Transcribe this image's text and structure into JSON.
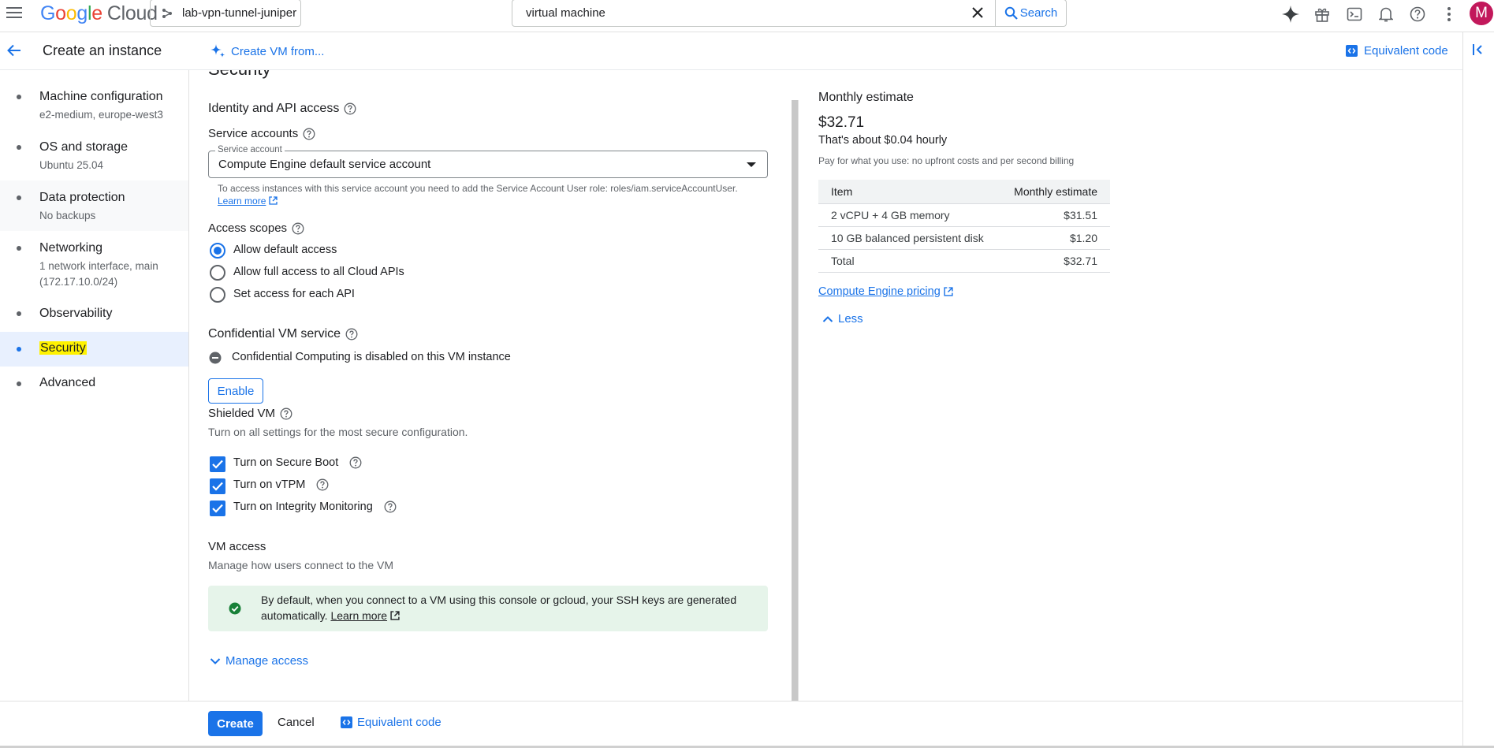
{
  "topbar": {
    "logo_google": [
      "G",
      "o",
      "o",
      "g",
      "l",
      "e"
    ],
    "logo_cloud": "Cloud",
    "project": "lab-vpn-tunnel-juniper",
    "search_value": "virtual machine",
    "search_button": "Search",
    "avatar_letter": "M"
  },
  "header": {
    "title": "Create an instance",
    "create_from": "Create VM from...",
    "equivalent_code": "Equivalent code"
  },
  "nav": {
    "items": [
      {
        "title": "Machine configuration",
        "sub": "e2-medium, europe-west3"
      },
      {
        "title": "OS and storage",
        "sub": "Ubuntu 25.04"
      },
      {
        "title": "Data protection",
        "sub": "No backups"
      },
      {
        "title": "Networking",
        "sub": "1 network interface, main",
        "sub2": "(172.17.10.0/24)"
      },
      {
        "title": "Observability"
      },
      {
        "title": "Security"
      },
      {
        "title": "Advanced"
      }
    ]
  },
  "main": {
    "section_title": "Security",
    "identity_title": "Identity and API access",
    "service_accounts_label": "Service accounts",
    "service_account_float": "Service account",
    "service_account_value": "Compute Engine default service account",
    "sa_help": "To access instances with this service account you need to add the Service Account User role: roles/iam.serviceAccountUser.",
    "learn_more": "Learn more",
    "access_scopes_label": "Access scopes",
    "scopes": [
      "Allow default access",
      "Allow full access to all Cloud APIs",
      "Set access for each API"
    ],
    "scopes_selected": 0,
    "confidential_title": "Confidential VM service",
    "confidential_status": "Confidential Computing is disabled on this VM instance",
    "enable_button": "Enable",
    "shielded_title": "Shielded VM",
    "shielded_desc": "Turn on all settings for the most secure configuration.",
    "shielded_options": [
      "Turn on Secure Boot",
      "Turn on vTPM",
      "Turn on Integrity Monitoring"
    ],
    "vm_access_title": "VM access",
    "vm_access_desc": "Manage how users connect to the VM",
    "info_text": "By default, when you connect to a VM using this console or gcloud, your SSH keys are generated automatically.",
    "info_link": "Learn more",
    "manage_access": "Manage access"
  },
  "estimate": {
    "title": "Monthly estimate",
    "price": "$32.71",
    "hourly": "That's about $0.04 hourly",
    "note": "Pay for what you use: no upfront costs and per second billing",
    "col_item": "Item",
    "col_estimate": "Monthly estimate",
    "rows": [
      {
        "item": "2 vCPU + 4 GB memory",
        "cost": "$31.51"
      },
      {
        "item": "10 GB balanced persistent disk",
        "cost": "$1.20"
      },
      {
        "item": "Total",
        "cost": "$32.71"
      }
    ],
    "pricing_link": "Compute Engine pricing",
    "less": "Less"
  },
  "bottom": {
    "create": "Create",
    "cancel": "Cancel",
    "equivalent_code": "Equivalent code"
  }
}
